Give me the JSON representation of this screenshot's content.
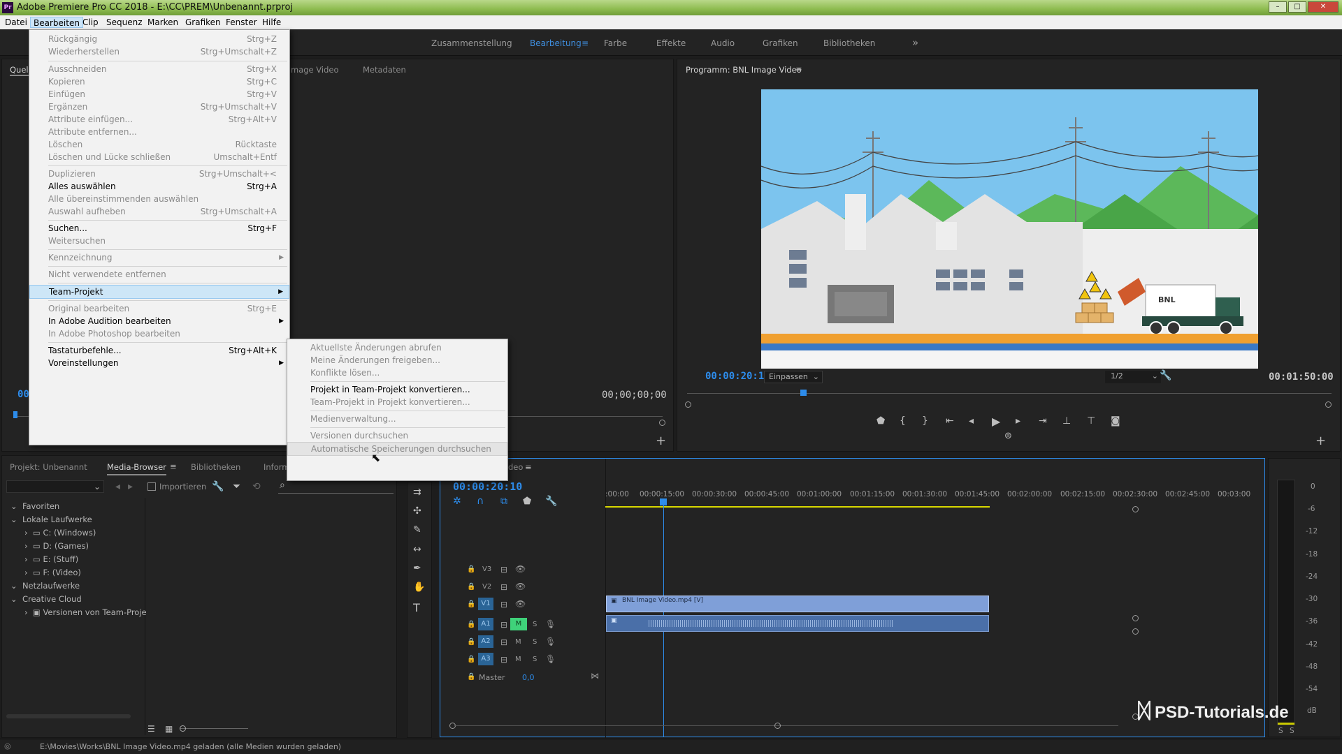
{
  "window": {
    "title": "Adobe Premiere Pro CC 2018 - E:\\CC\\PREM\\Unbenannt.prproj",
    "logo": "Pr"
  },
  "menubar": [
    "Datei",
    "Bearbeiten",
    "Clip",
    "Sequenz",
    "Marken",
    "Grafiken",
    "Fenster",
    "Hilfe"
  ],
  "workspaces": [
    "Zusammenstellung",
    "Bearbeitung",
    "Farbe",
    "Effekte",
    "Audio",
    "Grafiken",
    "Bibliotheken"
  ],
  "more_glyph": "»",
  "source": {
    "tabs": [
      "Quell",
      "mage Video",
      "Metadaten"
    ],
    "tc_left": "00",
    "tc_right": "00;00;00;00"
  },
  "program": {
    "title": "Programm: BNL Image Video",
    "tc": "00:00:20:10",
    "fit": "Einpassen",
    "res": "1/2",
    "duration": "00:01:50:00",
    "truck_brand": "BNL"
  },
  "edit_menu": [
    {
      "label": "Rückgängig",
      "shortcut": "Strg+Z",
      "disabled": true
    },
    {
      "label": "Wiederherstellen",
      "shortcut": "Strg+Umschalt+Z",
      "disabled": true
    },
    {
      "label": "Ausschneiden",
      "shortcut": "Strg+X",
      "disabled": true
    },
    {
      "label": "Kopieren",
      "shortcut": "Strg+C",
      "disabled": true
    },
    {
      "label": "Einfügen",
      "shortcut": "Strg+V",
      "disabled": true
    },
    {
      "label": "Ergänzen",
      "shortcut": "Strg+Umschalt+V",
      "disabled": true
    },
    {
      "label": "Attribute einfügen...",
      "shortcut": "Strg+Alt+V",
      "disabled": true
    },
    {
      "label": "Attribute entfernen...",
      "shortcut": "",
      "disabled": true
    },
    {
      "label": "Löschen",
      "shortcut": "Rücktaste",
      "disabled": true
    },
    {
      "label": "Löschen und Lücke schließen",
      "shortcut": "Umschalt+Entf",
      "disabled": true
    },
    {
      "label": "Duplizieren",
      "shortcut": "Strg+Umschalt+<",
      "disabled": true
    },
    {
      "label": "Alles auswählen",
      "shortcut": "Strg+A",
      "disabled": false
    },
    {
      "label": "Alle übereinstimmenden auswählen",
      "shortcut": "",
      "disabled": true
    },
    {
      "label": "Auswahl aufheben",
      "shortcut": "Strg+Umschalt+A",
      "disabled": true
    },
    {
      "label": "Suchen...",
      "shortcut": "Strg+F",
      "disabled": false
    },
    {
      "label": "Weitersuchen",
      "shortcut": "",
      "disabled": true
    },
    {
      "label": "Kennzeichnung",
      "shortcut": "",
      "disabled": true
    },
    {
      "label": "Nicht verwendete entfernen",
      "shortcut": "",
      "disabled": true
    },
    {
      "label": "Team-Projekt",
      "shortcut": "",
      "disabled": false
    },
    {
      "label": "Original bearbeiten",
      "shortcut": "Strg+E",
      "disabled": true
    },
    {
      "label": "In Adobe Audition bearbeiten",
      "shortcut": "",
      "disabled": false
    },
    {
      "label": "In Adobe Photoshop bearbeiten",
      "shortcut": "",
      "disabled": true
    },
    {
      "label": "Tastaturbefehle...",
      "shortcut": "Strg+Alt+K",
      "disabled": false
    },
    {
      "label": "Voreinstellungen",
      "shortcut": "",
      "disabled": false
    }
  ],
  "team_menu": [
    {
      "label": "Aktuellste Änderungen abrufen",
      "disabled": true
    },
    {
      "label": "Meine Änderungen freigeben...",
      "disabled": true
    },
    {
      "label": "Konflikte lösen...",
      "disabled": true
    },
    {
      "label": "Projekt in Team-Projekt konvertieren...",
      "disabled": false
    },
    {
      "label": "Team-Projekt in Projekt konvertieren...",
      "disabled": true
    },
    {
      "label": "Medienverwaltung...",
      "disabled": true
    },
    {
      "label": "Versionen durchsuchen",
      "disabled": true
    },
    {
      "label": "Automatische Speicherungen durchsuchen",
      "disabled": true
    }
  ],
  "project_panel": {
    "tabs": [
      "Projekt: Unbenannt",
      "Media-Browser",
      "Bibliotheken",
      "Inform"
    ],
    "import_label": "Importieren",
    "tree": [
      "Favoriten",
      "Lokale Laufwerke",
      "C: (Windows)",
      "D: (Games)",
      "E: (Stuff)",
      "F: (Video)",
      "Netzlaufwerke",
      "Creative Cloud",
      "Versionen von Team-Proje"
    ]
  },
  "timeline": {
    "tab": "deo",
    "tc": "00:00:20:10",
    "ruler": [
      ":00:00",
      "00:00:15:00",
      "00:00:30:00",
      "00:00:45:00",
      "00:01:00:00",
      "00:01:15:00",
      "00:01:30:00",
      "00:01:45:00",
      "00:02:00:00",
      "00:02:15:00",
      "00:02:30:00",
      "00:02:45:00",
      "00:03:00"
    ],
    "tracks": [
      "V3",
      "V2",
      "V1",
      "A1",
      "A2",
      "A3"
    ],
    "master": "Master",
    "master_val": "0,0",
    "clip": "BNL Image Video.mp4 [V]",
    "m": "M",
    "s": "S"
  },
  "meter_labels": [
    "0",
    "-6",
    "-12",
    "-18",
    "-24",
    "-30",
    "-36",
    "-42",
    "-48",
    "-54",
    "dB"
  ],
  "meter_foot": [
    "S",
    "S"
  ],
  "statusbar": "E:\\Movies\\Works\\BNL Image Video.mp4 geladen (alle Medien wurden geladen)",
  "watermark": "PSD-Tutorials.de"
}
